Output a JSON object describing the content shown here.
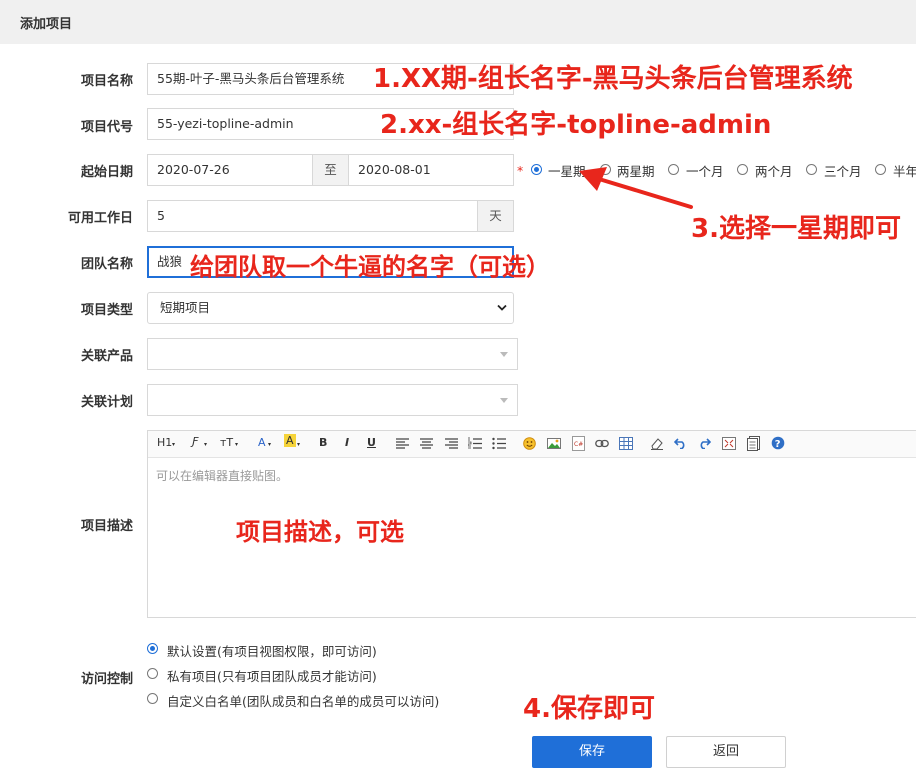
{
  "header": {
    "title": "添加项目"
  },
  "form": {
    "name": {
      "label": "项目名称",
      "value": "55期-叶子-黑马头条后台管理系统"
    },
    "code": {
      "label": "项目代号",
      "value": "55-yezi-topline-admin"
    },
    "dates": {
      "label": "起始日期",
      "start": "2020-07-26",
      "separator": "至",
      "end": "2020-08-01",
      "required_mark": "*",
      "options": [
        "一星期",
        "两星期",
        "一个月",
        "两个月",
        "三个月",
        "半年"
      ],
      "selected": "一星期"
    },
    "workdays": {
      "label": "可用工作日",
      "value": "5",
      "unit": "天"
    },
    "team": {
      "label": "团队名称",
      "value": "战狼"
    },
    "type": {
      "label": "项目类型",
      "value": "短期项目"
    },
    "product": {
      "label": "关联产品",
      "value": ""
    },
    "plan": {
      "label": "关联计划",
      "value": ""
    },
    "description": {
      "label": "项目描述",
      "placeholder": "可以在编辑器直接贴图。",
      "toolbar": [
        "H1",
        "Ƒ",
        "тT",
        "A",
        "A",
        "B",
        "I",
        "U"
      ]
    },
    "access": {
      "label": "访问控制",
      "options": [
        "默认设置(有项目视图权限，即可访问)",
        "私有项目(只有项目团队成员才能访问)",
        "自定义白名单(团队成员和白名单的成员可以访问)"
      ],
      "selected": "默认设置(有项目视图权限，即可访问)"
    }
  },
  "buttons": {
    "save": "保存",
    "back": "返回"
  },
  "annotations": {
    "a1": "1.XX期-组长名字-黑马头条后台管理系统",
    "a2": "2.xx-组长名字-topline-admin",
    "a3": "3.选择一星期即可",
    "a4": "给团队取一个牛逼的名字（可选）",
    "a5": "项目描述，可选",
    "a6": "4.保存即可"
  },
  "colors": {
    "primary": "#1f6fd8",
    "annotation": "#e8261c",
    "highlight": "#f6d43a"
  }
}
